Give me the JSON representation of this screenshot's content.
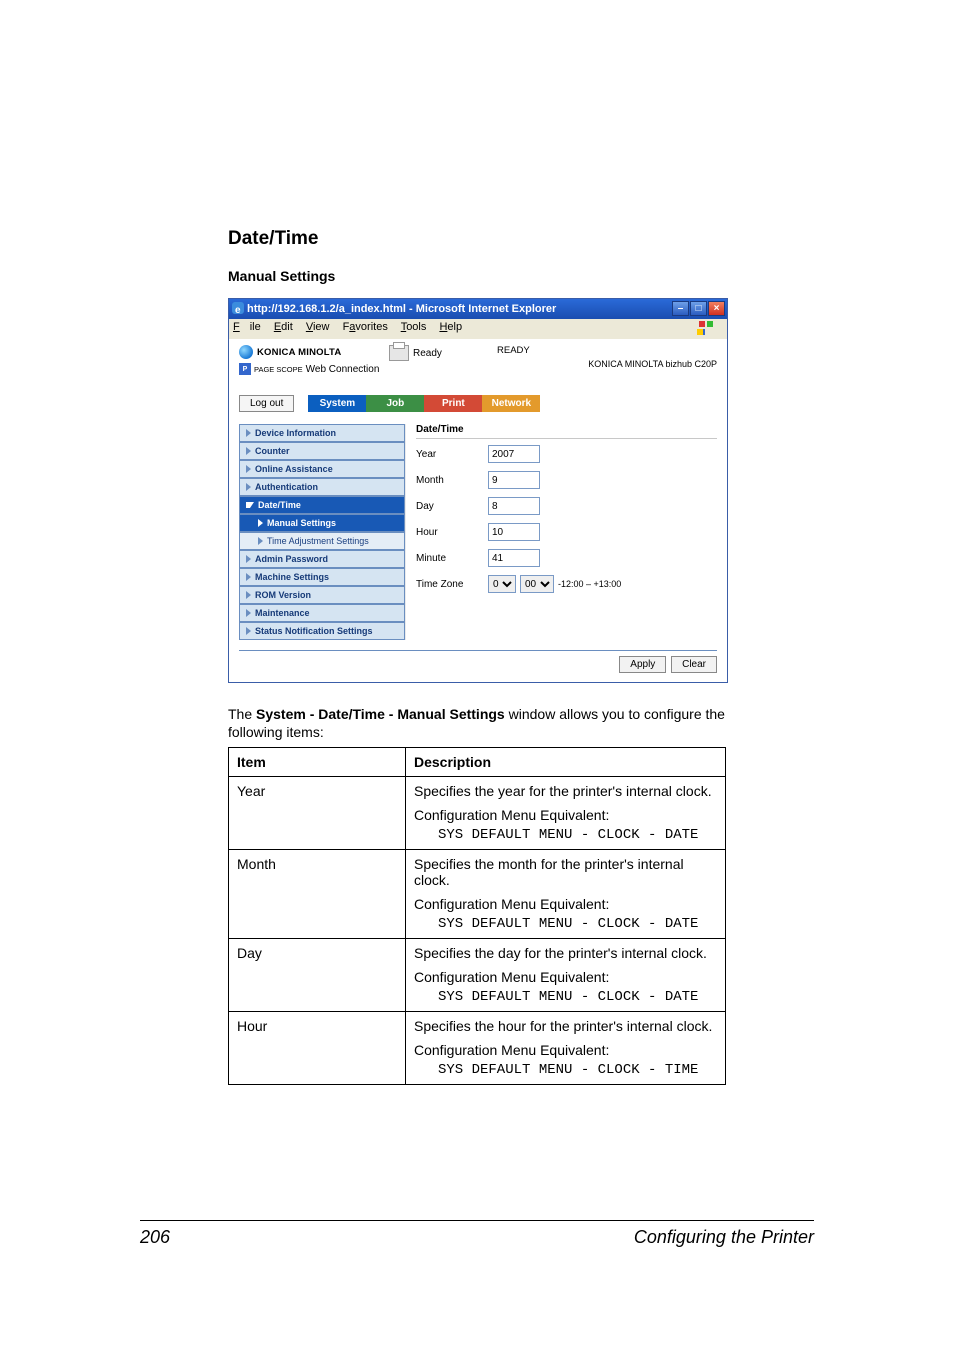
{
  "page": {
    "number": "206",
    "section": "Configuring the Printer"
  },
  "heading_date_time": "Date/Time",
  "heading_manual": "Manual Settings",
  "paragraph": {
    "pre": "The ",
    "bold": "System - Date/Time - Manual Settings",
    "post": " window allows you to configure the following items:"
  },
  "browser": {
    "title": "http://192.168.1.2/a_index.html - Microsoft Internet Explorer",
    "menu": {
      "file": "File",
      "edit": "Edit",
      "view": "View",
      "fav": "Favorites",
      "tools": "Tools",
      "help": "Help"
    },
    "brand": "KONICA MINOLTA",
    "sub_brand_prefix": "PAGE SCOPE",
    "sub_brand": "Web Connection",
    "ready_label": "Ready",
    "status": "READY",
    "model": "KONICA MINOLTA bizhub C20P",
    "logout": "Log out",
    "tabs": {
      "system": "System",
      "job": "Job",
      "print": "Print",
      "network": "Network"
    },
    "sidebar": {
      "items": [
        "Device Information",
        "Counter",
        "Online Assistance",
        "Authentication",
        "Date/Time",
        "Manual Settings",
        "Time Adjustment Settings",
        "Admin Password",
        "Machine Settings",
        "ROM Version",
        "Maintenance",
        "Status Notification Settings"
      ]
    },
    "main": {
      "title": "Date/Time",
      "year_label": "Year",
      "year_val": "2007",
      "month_label": "Month",
      "month_val": "9",
      "day_label": "Day",
      "day_val": "8",
      "hour_label": "Hour",
      "hour_val": "10",
      "minute_label": "Minute",
      "minute_val": "41",
      "tz_label": "Time Zone",
      "tz_sel1": "0",
      "tz_sel2": "00",
      "tz_note": "-12:00 – +13:00"
    },
    "footer": {
      "apply": "Apply",
      "clear": "Clear"
    }
  },
  "table": {
    "head": {
      "item": "Item",
      "desc": "Description"
    },
    "rows": [
      {
        "item": "Year",
        "spec": "Specifies the year for the printer's internal clock.",
        "conf": "Configuration Menu Equivalent:",
        "mono": "SYS DEFAULT MENU - CLOCK - DATE"
      },
      {
        "item": "Month",
        "spec": "Specifies the month for the printer's internal clock.",
        "conf": "Configuration Menu Equivalent:",
        "mono": "SYS DEFAULT MENU - CLOCK - DATE"
      },
      {
        "item": "Day",
        "spec": "Specifies the day for the printer's internal clock.",
        "conf": "Configuration Menu Equivalent:",
        "mono": "SYS DEFAULT MENU - CLOCK - DATE"
      },
      {
        "item": "Hour",
        "spec": "Specifies the hour for the printer's internal clock.",
        "conf": "Configuration Menu Equivalent:",
        "mono": "SYS DEFAULT MENU - CLOCK - TIME"
      }
    ]
  }
}
